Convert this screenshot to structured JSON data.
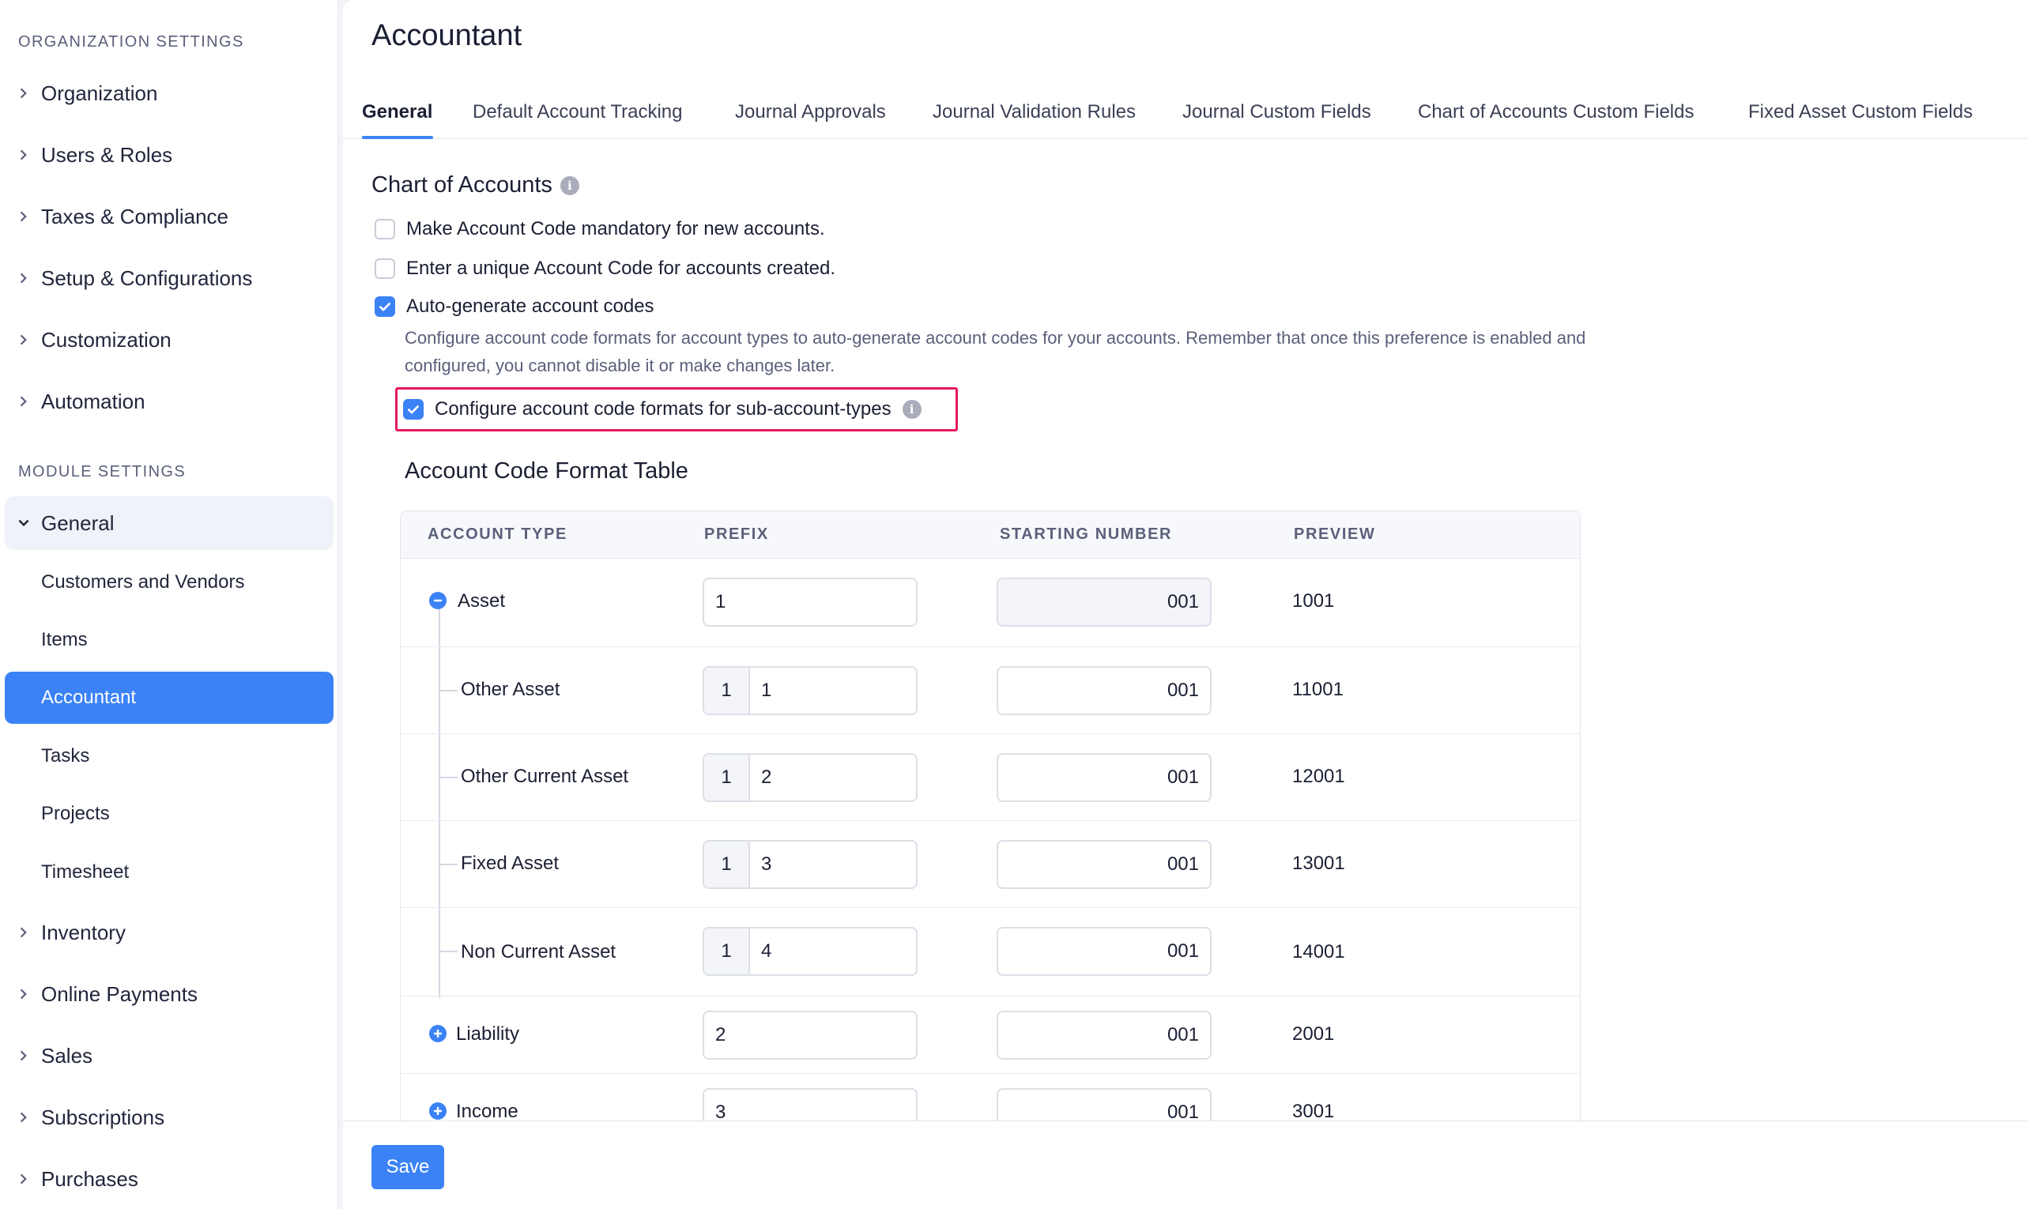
{
  "sidebar": {
    "org_heading": "ORGANIZATION SETTINGS",
    "org_items": [
      "Organization",
      "Users & Roles",
      "Taxes & Compliance",
      "Setup & Configurations",
      "Customization",
      "Automation"
    ],
    "module_heading": "MODULE SETTINGS",
    "general_label": "General",
    "general_sub": [
      "Customers and Vendors",
      "Items",
      "Accountant",
      "Tasks",
      "Projects",
      "Timesheet"
    ],
    "module_items": [
      "Inventory",
      "Online Payments",
      "Sales",
      "Subscriptions",
      "Purchases"
    ]
  },
  "page": {
    "title": "Accountant",
    "tabs": [
      "General",
      "Default Account Tracking",
      "Journal Approvals",
      "Journal Validation Rules",
      "Journal Custom Fields",
      "Chart of Accounts Custom Fields",
      "Fixed Asset Custom Fields"
    ]
  },
  "coa": {
    "title": "Chart of Accounts",
    "options": [
      {
        "label": "Make Account Code mandatory for new accounts.",
        "checked": false
      },
      {
        "label": "Enter a unique Account Code for accounts created.",
        "checked": false
      },
      {
        "label": "Auto-generate account codes",
        "checked": true
      }
    ],
    "help_text": "Configure account code formats for account types to auto-generate account codes for your accounts. Remember that once this preference is enabled and configured, you cannot disable it or make changes later.",
    "sub_option": {
      "label": "Configure account code formats for sub-account-types",
      "checked": true
    }
  },
  "table": {
    "title": "Account Code Format Table",
    "headers": [
      "ACCOUNT TYPE",
      "PREFIX",
      "STARTING NUMBER",
      "PREVIEW"
    ],
    "rows": [
      {
        "name": "Asset",
        "prefix": "1",
        "start": "001",
        "preview": "1001"
      },
      {
        "name": "Other Asset",
        "parent_prefix": "1",
        "prefix": "1",
        "start": "001",
        "preview": "11001"
      },
      {
        "name": "Other Current Asset",
        "parent_prefix": "1",
        "prefix": "2",
        "start": "001",
        "preview": "12001"
      },
      {
        "name": "Fixed Asset",
        "parent_prefix": "1",
        "prefix": "3",
        "start": "001",
        "preview": "13001"
      },
      {
        "name": "Non Current Asset",
        "parent_prefix": "1",
        "prefix": "4",
        "start": "001",
        "preview": "14001"
      },
      {
        "name": "Liability",
        "prefix": "2",
        "start": "001",
        "preview": "2001"
      },
      {
        "name": "Income",
        "prefix": "3",
        "start": "001",
        "preview": "3001"
      }
    ]
  },
  "footer": {
    "save_label": "Save"
  },
  "colors": {
    "accent": "#3b82f6",
    "highlight": "#e5195e"
  }
}
